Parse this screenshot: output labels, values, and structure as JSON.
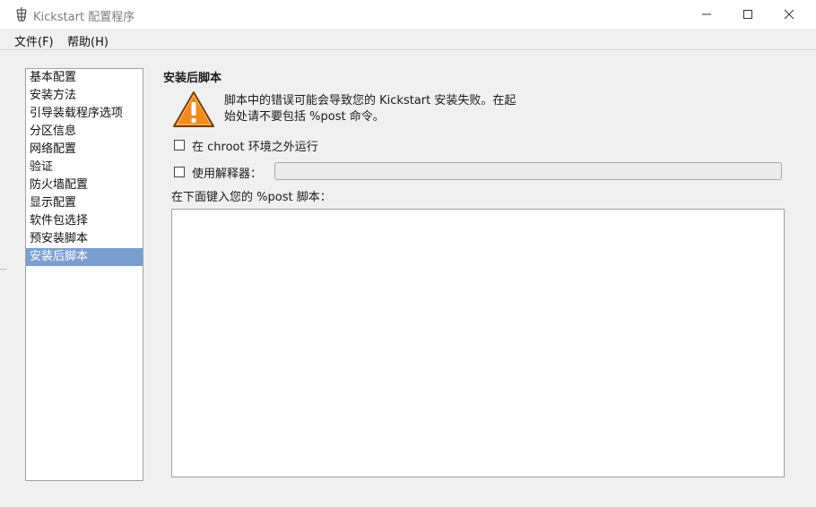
{
  "window": {
    "title": "Kickstart 配置程序",
    "icon": "kickstart-app-icon",
    "controls": [
      "minimize-icon",
      "maximize-icon",
      "close-icon"
    ]
  },
  "menu": {
    "file": "文件(F)",
    "help": "帮助(H)"
  },
  "sidebar": {
    "selected_index": 10,
    "items": [
      {
        "label": "基本配置"
      },
      {
        "label": "安装方法"
      },
      {
        "label": "引导装载程序选项"
      },
      {
        "label": "分区信息"
      },
      {
        "label": "网络配置"
      },
      {
        "label": "验证"
      },
      {
        "label": "防火墙配置"
      },
      {
        "label": "显示配置"
      },
      {
        "label": "软件包选择"
      },
      {
        "label": "预安装脚本"
      },
      {
        "label": "安装后脚本"
      }
    ]
  },
  "main": {
    "title": "安装后脚本",
    "warning_icon": "warning-triangle-icon",
    "warning_line1": "脚本中的错误可能会导致您的 Kickstart 安装失败。在起",
    "warning_line2": "始处请不要包括 %post 命令。",
    "chroot_label": "在 chroot 环境之外运行",
    "chroot_checked": false,
    "interpreter_label": "使用解释器：",
    "interpreter_checked": false,
    "interpreter_value": "",
    "script_label": "在下面键入您的 %post 脚本：",
    "script_value": ""
  },
  "colors": {
    "selected_bg": "#7a9fcf",
    "warning_orange": "#f08a1c"
  }
}
